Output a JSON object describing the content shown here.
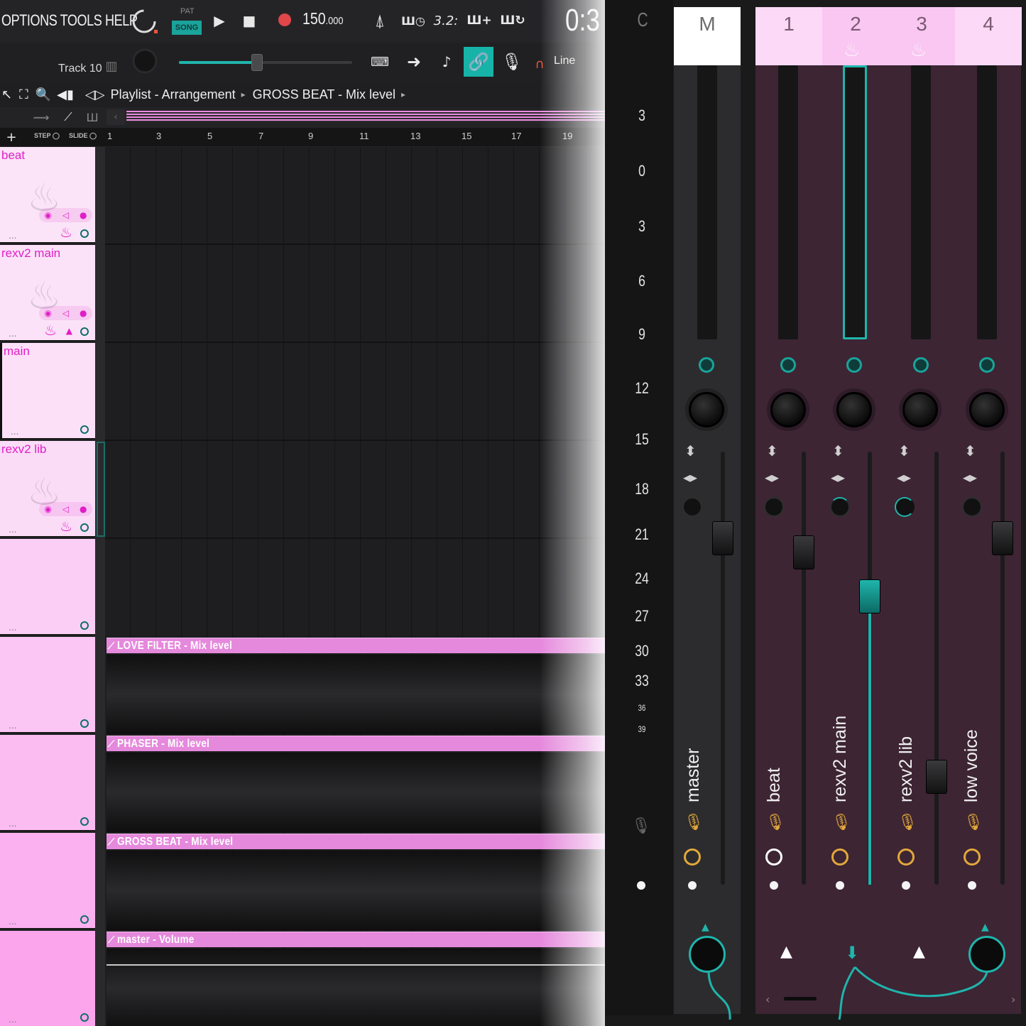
{
  "menu": {
    "text": "OPTIONS TOOLS HELP"
  },
  "transport": {
    "pat_label": "PAT",
    "song_label": "SONG",
    "tempo_int": "150",
    "tempo_dec": ".000",
    "time": "0:3",
    "accent": "#1fb5ab"
  },
  "secondbar": {
    "track_label": "Track 10",
    "line_label": "Line",
    "master_volume": 0.45
  },
  "breadcrumb": {
    "part1": "Playlist - Arrangement",
    "part2": "GROSS BEAT - Mix level"
  },
  "ruler": {
    "step_label": "STEP",
    "slide_label": "SLIDE",
    "bars": [
      "1",
      "3",
      "5",
      "7",
      "9",
      "11",
      "13",
      "15",
      "17",
      "19"
    ]
  },
  "tracks": [
    {
      "name": "beat"
    },
    {
      "name": "rexv2 main"
    },
    {
      "name": "main"
    },
    {
      "name": "rexv2 lib"
    },
    {
      "name": ""
    },
    {
      "name": ""
    },
    {
      "name": ""
    },
    {
      "name": ""
    },
    {
      "name": ""
    },
    {
      "name": ""
    }
  ],
  "clips": [
    {
      "label": "LOVE FILTER - Mix level"
    },
    {
      "label": "PHASER - Mix level"
    },
    {
      "label": "GROSS BEAT - Mix level"
    },
    {
      "label": "master - Volume"
    }
  ],
  "mixer": {
    "scale_head": "C",
    "db_scale": [
      "3",
      "0",
      "3",
      "6",
      "9",
      "12",
      "15",
      "18",
      "21",
      "24",
      "27",
      "30",
      "33",
      "36",
      "39"
    ],
    "strips": [
      {
        "head": "M",
        "name": "master"
      },
      {
        "head": "1",
        "name": "beat"
      },
      {
        "head": "2",
        "name": "rexv2 main"
      },
      {
        "head": "3",
        "name": "rexv2 lib"
      },
      {
        "head": "4",
        "name": "low voice"
      }
    ]
  }
}
